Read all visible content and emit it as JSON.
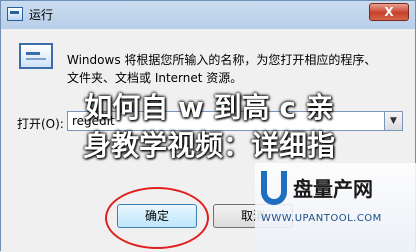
{
  "window": {
    "title": "运行",
    "close_symbol": "X"
  },
  "dialog": {
    "description_line1": "Windows 将根据您所输入的名称，为您打开相应的程序、",
    "description_line2": "文件夹、文档或 Internet 资源。",
    "open_label": "打开(O):",
    "open_value": "regedit",
    "ok_label": "确定",
    "cancel_label": "取消"
  },
  "overlay": {
    "line1": "如何自 w 到高 c 亲",
    "line2": "身教学视频：详细指"
  },
  "watermark": {
    "brand": "盘量产网",
    "url": "WWW.UPANTOOL.COM"
  },
  "icons": [
    "run-app-icon",
    "run-dialog-icon",
    "dropdown-arrow-icon",
    "u-logo-icon"
  ],
  "colors": {
    "highlight_circle": "#e02020",
    "logo_blue": "#1f6fc0"
  }
}
